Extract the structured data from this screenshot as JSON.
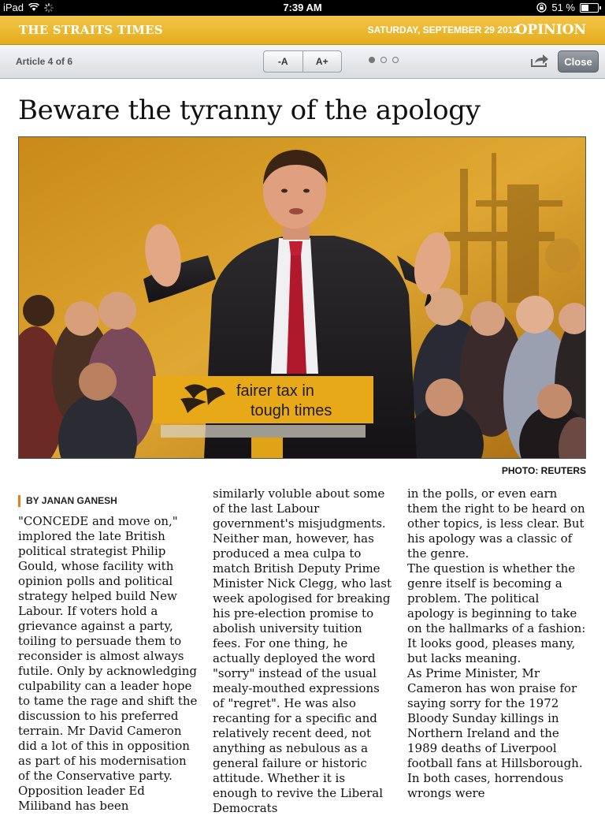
{
  "status_bar": {
    "device": "iPad",
    "time": "7:39 AM",
    "battery": "51 %",
    "battery_level": 0.51
  },
  "masthead": {
    "logo": "THE STRAITS TIMES",
    "date": "SATURDAY, SEPTEMBER 29 2012",
    "section": "OPINION"
  },
  "toolbar": {
    "article_count": "Article 4 of 6",
    "font_smaller": "-A",
    "font_larger": "A+",
    "page_dots": [
      true,
      false,
      false
    ],
    "close_label": "Close"
  },
  "article": {
    "headline": "Beware the tyranny of the apology",
    "photo": {
      "podium_text_1": "fairer tax in",
      "podium_text_2": "tough times"
    },
    "credit": "PHOTO: REUTERS",
    "byline": "BY JANAN GANESH",
    "col1": "\"CONCEDE and move on,\" implored the late British political strategist Philip Gould, whose facility with opinion polls and political strategy helped build New Labour. If voters hold a grievance against a party, toiling to persuade them to reconsider is almost always futile. Only by acknowledging culpability can a leader hope to tame the rage and shift the discussion to his preferred terrain. Mr David Cameron did a lot of this in opposition as part of his modernisation of the Conservative party. Opposition leader Ed Miliband has been",
    "col2_p1": "similarly voluble about some of the last Labour government's misjudgments.",
    "col2_p2": " Neither man, however, has produced a mea culpa to match British Deputy Prime Minister Nick Clegg, who last week apologised for breaking his pre-election promise to abolish university tuition fees. For one thing, he actually deployed the word \"sorry\" instead of the usual mealy-mouthed expressions of \"regret\". He was also recanting for a specific and relatively recent deed, not anything as nebulous as a general failure or historic attitude. Whether it is enough to revive the Liberal Democrats",
    "col3_p1": "in the polls, or even earn them the right to be heard on other topics, is less clear. But his apology was a classic of the genre.",
    "col3_p2": " The question is whether the genre itself is becoming a problem. The political apology is beginning to take on the hallmarks of a fashion: It looks good, pleases many, but lacks meaning.",
    "col3_p3": " As Prime Minister, Mr Cameron has won praise for saying sorry for the 1972 Bloody Sunday killings in Northern Ireland and the 1989 deaths of Liverpool football fans at Hillsborough. In both cases, horrendous wrongs were"
  }
}
